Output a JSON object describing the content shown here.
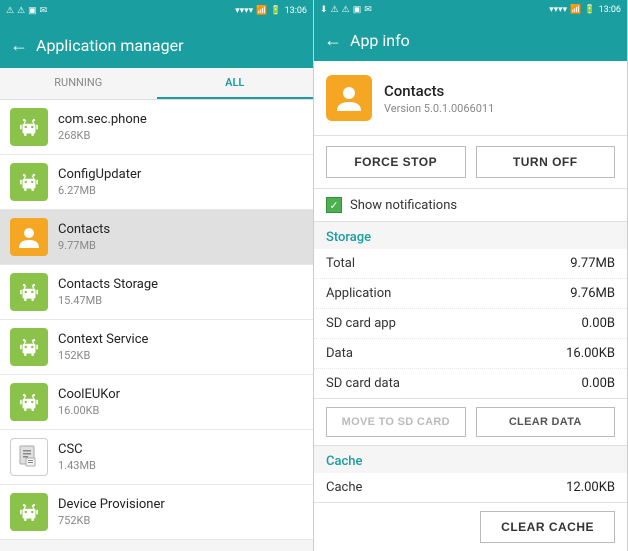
{
  "left_panel": {
    "status_bar": {
      "time": "13:06",
      "battery": "81%"
    },
    "header": {
      "back_label": "←",
      "title": "Application manager"
    },
    "tabs": [
      {
        "id": "running",
        "label": "RUNNING",
        "active": false
      },
      {
        "id": "all",
        "label": "ALL",
        "active": true
      }
    ],
    "apps": [
      {
        "id": "com-sec-phone",
        "name": "com.sec.phone",
        "size": "268KB",
        "icon_type": "robot",
        "selected": false
      },
      {
        "id": "config-updater",
        "name": "ConfigUpdater",
        "size": "6.27MB",
        "icon_type": "robot",
        "selected": false
      },
      {
        "id": "contacts",
        "name": "Contacts",
        "size": "9.77MB",
        "icon_type": "contact",
        "selected": true
      },
      {
        "id": "contacts-storage",
        "name": "Contacts Storage",
        "size": "15.47MB",
        "icon_type": "robot",
        "selected": false
      },
      {
        "id": "context-service",
        "name": "Context Service",
        "size": "152KB",
        "icon_type": "robot",
        "selected": false
      },
      {
        "id": "cool-eu-kor",
        "name": "CoolEUKor",
        "size": "16.00KB",
        "icon_type": "robot",
        "selected": false
      },
      {
        "id": "csc",
        "name": "CSC",
        "size": "1.43MB",
        "icon_type": "document",
        "selected": false
      },
      {
        "id": "device-provisioner",
        "name": "Device Provisioner",
        "size": "752KB",
        "icon_type": "robot",
        "selected": false
      }
    ]
  },
  "right_panel": {
    "status_bar": {
      "time": "13:06",
      "battery": "81%"
    },
    "header": {
      "back_label": "←",
      "title": "App info"
    },
    "app": {
      "name": "Contacts",
      "version": "Version 5.0.1.0066011"
    },
    "buttons": {
      "force_stop": "FORCE STOP",
      "turn_off": "TURN OFF"
    },
    "notifications": {
      "label": "Show notifications"
    },
    "storage": {
      "section_title": "Storage",
      "rows": [
        {
          "label": "Total",
          "value": "9.77MB"
        },
        {
          "label": "Application",
          "value": "9.76MB"
        },
        {
          "label": "SD card app",
          "value": "0.00B"
        },
        {
          "label": "Data",
          "value": "16.00KB"
        },
        {
          "label": "SD card data",
          "value": "0.00B"
        }
      ],
      "btn_move": "MOVE TO SD CARD",
      "btn_clear_data": "CLEAR DATA"
    },
    "cache": {
      "section_title": "Cache",
      "rows": [
        {
          "label": "Cache",
          "value": "12.00KB"
        }
      ],
      "btn_clear_cache": "CLEAR CACHE"
    }
  }
}
